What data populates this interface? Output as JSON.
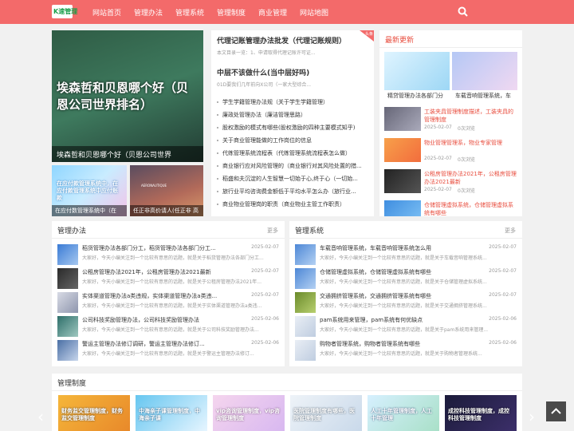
{
  "nav": {
    "logo_text": "K速管理",
    "items": [
      "网站首页",
      "管理办法",
      "管理系统",
      "管理制度",
      "商业管理",
      "网站地图"
    ]
  },
  "hero": {
    "main_caption": "埃森哲和贝恩哪个好（贝恩公司世界",
    "main_image_text": "埃森哲和贝恩哪个好（贝恩公司世界排名）",
    "sub1_caption": "在应付数管理系统中（在",
    "sub1_text": "在应付款管理系统中，在应付款管理系统中应付账款",
    "sub2_caption": "任正非高价请人(任正非 高",
    "sub2_text": "AERONAUTIQUE"
  },
  "featured": {
    "badge": "头条",
    "article1": {
      "title": "代理记账管理办法批发（代理记账规则）",
      "summary": "本文目录一览：1、申请取得代理记账许可证..."
    },
    "article2": {
      "title": "中层不该做什么(当中层好吗)",
      "summary": "01D要我们几年前向X公司（一家大型综合..."
    },
    "list": [
      "学生学籍管理办法规（关于学生学籍管理）",
      "廉政处管理办法（廉洁管理思路）",
      "股权激励的模式有哪些(股权激励的四种主要模式知乎)",
      "关于商业管理能做的工作岗位的信息",
      "代练管理系统流程表（代练管理系统流程表怎么做）",
      "商业银行应对风险管理的（商业银行对其风险处置的措...",
      "稻盛和夫沉淀的人生智慧一切始于心,终于心（一切始...",
      "旅行业平均咨询费金额低于平均水平怎么办（旅行业...",
      "商业物业管理岗的职责（商业物业主管工作职责）"
    ]
  },
  "latest": {
    "title": "最新更新",
    "top1_caption": "精贷管理办法各部门分",
    "top2_caption": "车载音响管理系统，车",
    "items": [
      {
        "title": "工装夹具管理制度描述，工装夹具的管理制度",
        "date": "2025-02-07",
        "views": "0次浏览"
      },
      {
        "title": "物业管理管理系，物业专家管理",
        "date": "2025-02-07",
        "views": "0次浏览"
      },
      {
        "title": "公租房管理办法2021年，公租房管理办法2021最新",
        "date": "2025-02-07",
        "views": "0次浏览"
      },
      {
        "title": "仓储管理虚拟系统，仓储管理虚拟系统有哪些",
        "date": "",
        "views": ""
      }
    ]
  },
  "mgmt_methods": {
    "title": "管理办法",
    "more": "更多",
    "rows": [
      {
        "title": "稻货管理办法各部门分工，稻货管理办法各部门分工...",
        "date": "2025-02-07",
        "summary": "大家好，今天小编关注到一个比较有意思的话题，就是关于稻货管理办法各部门分工..."
      },
      {
        "title": "公租房管理办法2021年，公租房管理办法2021最新",
        "date": "2025-02-07",
        "summary": "大家好，今天小编关注到一个比较有意思的话题，就是关于公租房管理办法2021年..."
      },
      {
        "title": "实体渠道管理办法a类违规，实体渠道管理办法a类违...",
        "date": "2025-02-07",
        "summary": "大家好，今天小编关注到一个比较有意思的话题，就是关于实体渠道管理办法a类违..."
      },
      {
        "title": "公司科技奖励管理办法，公司科技奖励管理办法",
        "date": "2025-02-06",
        "summary": "大家好，今天小编关注到一个比较有意思的话题，就是关于公司科技奖励管理办法..."
      },
      {
        "title": "警运主管理办法修订调研，警运主管理办法修订...",
        "date": "2025-02-06",
        "summary": "大家好，今天小编关注到一个比较有意思的话题，就是关于警运主管理办法修订..."
      }
    ]
  },
  "mgmt_systems": {
    "title": "管理系统",
    "more": "更多",
    "rows": [
      {
        "title": "车载音响管理系统，车载音响管理系统怎么用",
        "date": "2025-02-07",
        "summary": "大家好，今天小编关注到一个比较有意思的话题，就是关于车载音响管理系统..."
      },
      {
        "title": "仓储管理虚拟系统，仓储管理虚拟系统有哪些",
        "date": "2025-02-07",
        "summary": "大家好，今天小编关注到一个比较有意思的话题，就是关于仓储管理虚拟系统..."
      },
      {
        "title": "交通拥挤管理系统，交通拥挤管理系统有哪些",
        "date": "2025-02-07",
        "summary": "大家好，今天小编关注到一个比较有意思的话题，就是关于交通拥挤管理系统..."
      },
      {
        "title": "pam系统用来管理，pam系统有何优缺点",
        "date": "2025-02-06",
        "summary": "大家好，今天小编关注到一个比较有意思的话题，就是关于pam系统用来管理..."
      },
      {
        "title": "购物者管理系统，购物者管理系统有哪些",
        "date": "2025-02-06",
        "summary": "大家好，今天小编关注到一个比较有意思的话题，就是关于购物者管理系统..."
      }
    ]
  },
  "mgmt_rules": {
    "title": "管理制度",
    "cards": [
      "财务监交管理制度，财务监交管理制度",
      "中海亲子课管理制度，中海亲子课",
      "vip咨询管理制度，vip咨询管理制度",
      "医院管理制度有哪些，医院管理制度",
      "人工十年管理制度，人工十年管理",
      "成控科技管理制度，成控科技管理制度"
    ]
  },
  "colors": {
    "nav": "#f36a6a",
    "accent": "#e84c3d"
  }
}
